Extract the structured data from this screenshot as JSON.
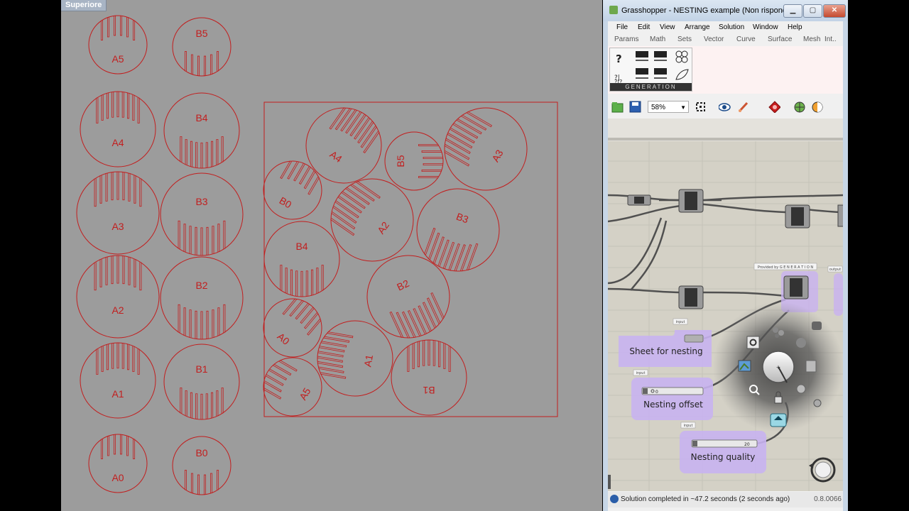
{
  "viewport": {
    "label": "Superiore",
    "line_color": "#c21e1e",
    "background": "#9c9c9c",
    "source_parts": [
      {
        "label": "A5"
      },
      {
        "label": "B5"
      },
      {
        "label": "A4"
      },
      {
        "label": "B4"
      },
      {
        "label": "A3"
      },
      {
        "label": "B3"
      },
      {
        "label": "A2"
      },
      {
        "label": "B2"
      },
      {
        "label": "A1"
      },
      {
        "label": "B1"
      },
      {
        "label": "A0"
      },
      {
        "label": "B0"
      }
    ],
    "nested_parts": [
      {
        "label": "A4"
      },
      {
        "label": "B5"
      },
      {
        "label": "A3"
      },
      {
        "label": "B0"
      },
      {
        "label": "A2"
      },
      {
        "label": "B3"
      },
      {
        "label": "B4"
      },
      {
        "label": "B2"
      },
      {
        "label": "A0"
      },
      {
        "label": "A1"
      },
      {
        "label": "A5"
      },
      {
        "label": "B1"
      }
    ]
  },
  "grasshopper": {
    "title": "Grasshopper - NESTING example (Non risponde)",
    "menu": [
      "File",
      "Edit",
      "View",
      "Arrange",
      "Solution",
      "Window",
      "Help"
    ],
    "tabs": [
      "Params",
      "Math",
      "Sets",
      "Vector",
      "Curve",
      "Surface",
      "Mesh",
      "Int.."
    ],
    "ribbon_panel_label": "GENERATION",
    "zoom": "58%",
    "canvas": {
      "provided_by": "Provided by G E N E R A T I O N",
      "input_tag": "input",
      "output_tag": "output",
      "groups": [
        {
          "label": "Sheet for nesting"
        },
        {
          "label": "Nesting offset",
          "slider_value": "0"
        },
        {
          "label": "Nesting quality",
          "slider_value": "20"
        }
      ]
    },
    "status": {
      "text": "Solution completed in ~47.2 seconds (2 seconds ago)",
      "version": "0.8.0066"
    }
  }
}
